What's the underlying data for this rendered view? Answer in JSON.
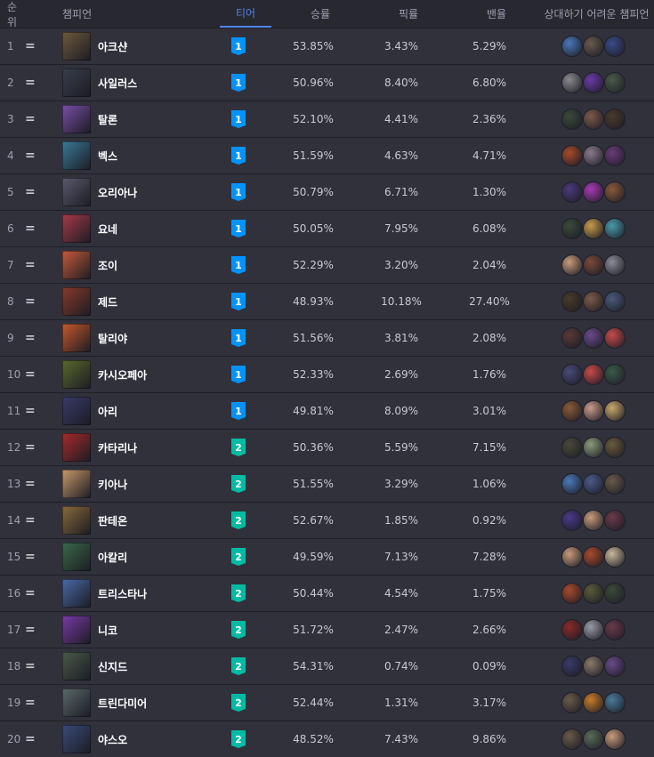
{
  "header": {
    "rank": "순위",
    "champion": "챔피언",
    "tier": "티어",
    "winrate": "승률",
    "pickrate": "픽률",
    "banrate": "밴율",
    "counters": "상대하기 어려운 챔피언"
  },
  "tier_colors": {
    "1": "#0093ff",
    "2": "#00bba3"
  },
  "rows": [
    {
      "rank": "1",
      "change": "=",
      "name": "아크샨",
      "tier": "1",
      "win": "53.85%",
      "pick": "3.43%",
      "ban": "5.29%",
      "color": "#6e5a3c",
      "counters": [
        "#4a78b8",
        "#6a5a4e",
        "#3a4a8a"
      ]
    },
    {
      "rank": "2",
      "change": "=",
      "name": "사일러스",
      "tier": "1",
      "win": "50.96%",
      "pick": "8.40%",
      "ban": "6.80%",
      "color": "#3a3e4e",
      "counters": [
        "#8a8a8e",
        "#6a3aa8",
        "#4a5a4a"
      ]
    },
    {
      "rank": "3",
      "change": "=",
      "name": "탈론",
      "tier": "1",
      "win": "52.10%",
      "pick": "4.41%",
      "ban": "2.36%",
      "color": "#7a4ea8",
      "counters": [
        "#3a4a3a",
        "#7a5a4a",
        "#4a3a2a"
      ]
    },
    {
      "rank": "4",
      "change": "=",
      "name": "벡스",
      "tier": "1",
      "win": "51.59%",
      "pick": "4.63%",
      "ban": "4.71%",
      "color": "#3a7a9a",
      "counters": [
        "#a84a2a",
        "#8a7a8a",
        "#6a3a7a"
      ]
    },
    {
      "rank": "5",
      "change": "=",
      "name": "오리아나",
      "tier": "1",
      "win": "50.79%",
      "pick": "6.71%",
      "ban": "1.30%",
      "color": "#5a5a6e",
      "counters": [
        "#4a3a7a",
        "#a83ab8",
        "#8a5a3a"
      ]
    },
    {
      "rank": "6",
      "change": "=",
      "name": "요네",
      "tier": "1",
      "win": "50.05%",
      "pick": "7.95%",
      "ban": "6.08%",
      "color": "#a83a4a",
      "counters": [
        "#3a4a3a",
        "#c89a4a",
        "#4a9aa8"
      ]
    },
    {
      "rank": "7",
      "change": "=",
      "name": "조이",
      "tier": "1",
      "win": "52.29%",
      "pick": "3.20%",
      "ban": "2.04%",
      "color": "#c85a3a",
      "counters": [
        "#c89a7a",
        "#7a4a3a",
        "#8a8a9a"
      ]
    },
    {
      "rank": "8",
      "change": "=",
      "name": "제드",
      "tier": "1",
      "win": "48.93%",
      "pick": "10.18%",
      "ban": "27.40%",
      "color": "#8a3a2a",
      "counters": [
        "#4a3a2a",
        "#7a5a4a",
        "#4a5a7a"
      ]
    },
    {
      "rank": "9",
      "change": "=",
      "name": "탈리야",
      "tier": "1",
      "win": "51.56%",
      "pick": "3.81%",
      "ban": "2.08%",
      "color": "#c8582a",
      "counters": [
        "#5a3a3a",
        "#6a4a8a",
        "#c84a4a"
      ]
    },
    {
      "rank": "10",
      "change": "=",
      "name": "카시오페아",
      "tier": "1",
      "win": "52.33%",
      "pick": "2.69%",
      "ban": "1.76%",
      "color": "#5a6a2a",
      "counters": [
        "#4a4a7a",
        "#c84a4a",
        "#3a5a4a"
      ]
    },
    {
      "rank": "11",
      "change": "=",
      "name": "아리",
      "tier": "1",
      "win": "49.81%",
      "pick": "8.09%",
      "ban": "3.01%",
      "color": "#3a3a6a",
      "counters": [
        "#8a5a3a",
        "#c89a8a",
        "#c8a86a"
      ]
    },
    {
      "rank": "12",
      "change": "=",
      "name": "카타리나",
      "tier": "2",
      "win": "50.36%",
      "pick": "5.59%",
      "ban": "7.15%",
      "color": "#a82a2a",
      "counters": [
        "#4a4a3a",
        "#8a9a7a",
        "#6a5a3a"
      ]
    },
    {
      "rank": "13",
      "change": "=",
      "name": "키아나",
      "tier": "2",
      "win": "51.55%",
      "pick": "3.29%",
      "ban": "1.06%",
      "color": "#c89a6a",
      "counters": [
        "#4a7ab8",
        "#4a5a8a",
        "#6a5a4a"
      ]
    },
    {
      "rank": "14",
      "change": "=",
      "name": "판테온",
      "tier": "2",
      "win": "52.67%",
      "pick": "1.85%",
      "ban": "0.92%",
      "color": "#8a6a3a",
      "counters": [
        "#4a3a8a",
        "#c89a7a",
        "#6a3a4a"
      ]
    },
    {
      "rank": "15",
      "change": "=",
      "name": "아칼리",
      "tier": "2",
      "win": "49.59%",
      "pick": "7.13%",
      "ban": "7.28%",
      "color": "#3a6a4a",
      "counters": [
        "#c89a7a",
        "#a84a2a",
        "#c8b89a"
      ]
    },
    {
      "rank": "16",
      "change": "=",
      "name": "트리스타나",
      "tier": "2",
      "win": "50.44%",
      "pick": "4.54%",
      "ban": "1.75%",
      "color": "#4a6aa8",
      "counters": [
        "#a84a2a",
        "#5a5a3a",
        "#3a4a3a"
      ]
    },
    {
      "rank": "17",
      "change": "=",
      "name": "니코",
      "tier": "2",
      "win": "51.72%",
      "pick": "2.47%",
      "ban": "2.66%",
      "color": "#7a3aa8",
      "counters": [
        "#8a2a2a",
        "#9a9aa8",
        "#6a3a4a"
      ]
    },
    {
      "rank": "18",
      "change": "=",
      "name": "신지드",
      "tier": "2",
      "win": "54.31%",
      "pick": "0.74%",
      "ban": "0.09%",
      "color": "#4a5a4a",
      "counters": [
        "#3a3a6a",
        "#8a7a6a",
        "#6a4a8a"
      ]
    },
    {
      "rank": "19",
      "change": "=",
      "name": "트린다미어",
      "tier": "2",
      "win": "52.44%",
      "pick": "1.31%",
      "ban": "3.17%",
      "color": "#5a6a6a",
      "counters": [
        "#6a5a4a",
        "#c87a2a",
        "#4a7a9a"
      ]
    },
    {
      "rank": "20",
      "change": "=",
      "name": "야스오",
      "tier": "2",
      "win": "48.52%",
      "pick": "7.43%",
      "ban": "9.86%",
      "color": "#3a4a7a",
      "counters": [
        "#6a5a4a",
        "#5a6a5a",
        "#c89a7a"
      ]
    }
  ]
}
